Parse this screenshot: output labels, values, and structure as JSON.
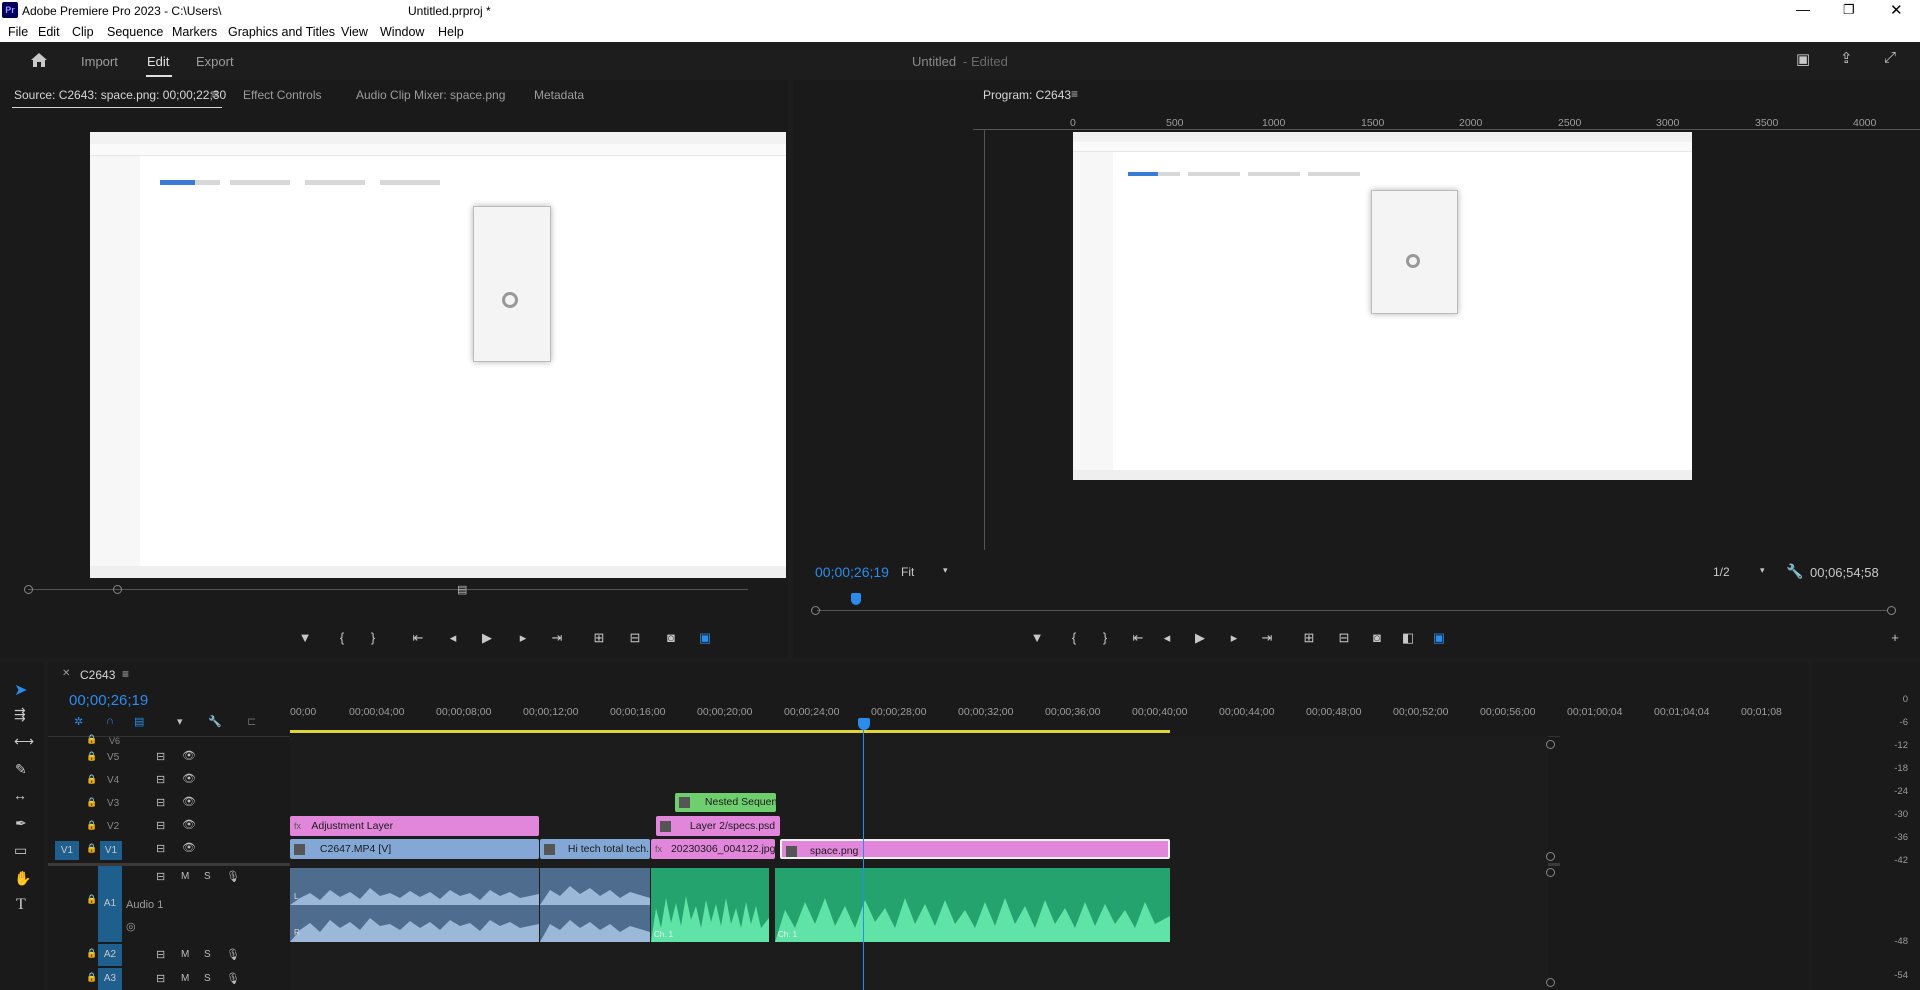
{
  "app": {
    "title": "Adobe Premiere Pro 2023 - C:\\Users\\",
    "doc_title": "Untitled.prproj *",
    "logo": "Pr"
  },
  "menu": [
    "File",
    "Edit",
    "Clip",
    "Sequence",
    "Markers",
    "Graphics and Titles",
    "View",
    "Window",
    "Help"
  ],
  "workspace": {
    "tabs": [
      "Import",
      "Edit",
      "Export"
    ],
    "active": "Edit",
    "project_name": "Untitled",
    "project_status": "- Edited"
  },
  "source_panel": {
    "tabs": [
      "Source: C2643: space.png: 00;00;22;30",
      "Effect Controls",
      "Audio Clip Mixer: space.png",
      "Metadata"
    ]
  },
  "program_panel": {
    "title": "Program: C2643",
    "timecode": "00;00;26;19",
    "fit": "Fit",
    "resolution": "1/2",
    "duration": "00;06;54;58",
    "ruler": [
      "0",
      "500",
      "1000",
      "1500",
      "2000",
      "2500",
      "3000",
      "3500",
      "4000"
    ]
  },
  "timeline": {
    "sequence": "C2643",
    "timecode": "00;00;26;19",
    "ruler": [
      "00;00",
      "00;00;04;00",
      "00;00;08;00",
      "00;00;12;00",
      "00;00;16;00",
      "00;00;20;00",
      "00;00;24;00",
      "00;00;28;00",
      "00;00;32;00",
      "00;00;36;00",
      "00;00;40;00",
      "00;00;44;00",
      "00;00;48;00",
      "00;00;52;00",
      "00;00;56;00",
      "00;01;00;04",
      "00;01;04;04",
      "00;01;08"
    ],
    "video_tracks": [
      "V6",
      "V5",
      "V4",
      "V3",
      "V2",
      "V1"
    ],
    "audio_tracks": [
      "A1",
      "A2",
      "A3"
    ],
    "source_patch_v": "V1",
    "audio1_name": "Audio 1",
    "clips": {
      "adjustment": "Adjustment Layer",
      "c2647": "C2647.MP4 [V]",
      "hitech": "Hi tech total tech.",
      "nested": "Nested Sequence",
      "layer2": "Layer 2/specs.psd",
      "jpg": "20230306_004122.jpg",
      "space": "space.png"
    },
    "audio_channel_labels": [
      "L",
      "R",
      "Ch. 1",
      "Ch. 1"
    ],
    "ms": [
      "M",
      "S"
    ]
  },
  "meter": [
    "0",
    "-6",
    "-12",
    "-18",
    "-24",
    "-30",
    "-36",
    "-42",
    "-48",
    "-54"
  ],
  "colors": {
    "accent": "#2d8ceb",
    "adjustment_clip": "#e286dc",
    "video_clip": "#83a8d6",
    "nested_clip": "#6fcf6f",
    "audio_clip": "#24a36f",
    "playhead": "#2d8ceb"
  }
}
